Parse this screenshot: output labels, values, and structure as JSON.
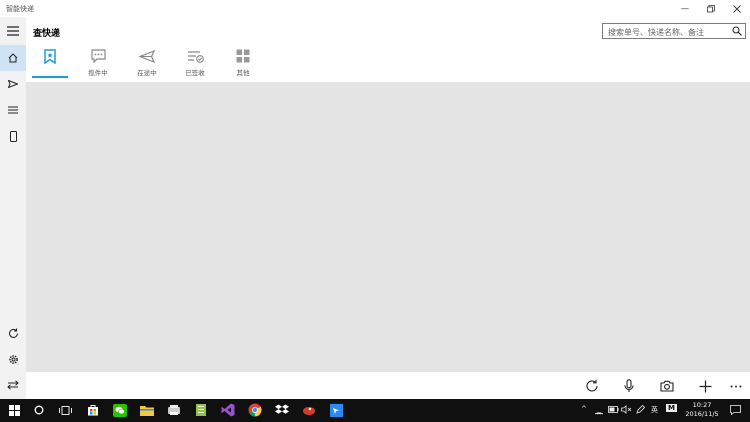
{
  "window": {
    "title": "智能快递",
    "controls": [
      "minimize-icon",
      "restore-icon",
      "close-icon"
    ]
  },
  "sidebar": {
    "items": [
      {
        "name": "menu-icon"
      },
      {
        "name": "home-icon",
        "active": true
      },
      {
        "name": "send-icon"
      },
      {
        "name": "list-icon"
      },
      {
        "name": "phone-icon"
      }
    ],
    "bottom": [
      {
        "name": "refresh-icon"
      },
      {
        "name": "settings-icon"
      },
      {
        "name": "switch-icon"
      }
    ]
  },
  "header": {
    "title": "查快递"
  },
  "search": {
    "placeholder": "搜索单号、快递名称、备注"
  },
  "tabs": [
    {
      "label": "",
      "icon": "bookmark-icon",
      "selected": true
    },
    {
      "label": "揽件中",
      "icon": "chat-icon"
    },
    {
      "label": "在途中",
      "icon": "send-icon"
    },
    {
      "label": "已签收",
      "icon": "checked-list-icon"
    },
    {
      "label": "其他",
      "icon": "grid-icon"
    }
  ],
  "command_bar": [
    "refresh-icon",
    "microphone-icon",
    "camera-icon",
    "add-icon",
    "more-icon"
  ],
  "taskbar": {
    "apps": [
      "start-icon",
      "cortana-icon",
      "task-view-icon",
      "store-icon",
      "wechat-icon",
      "file-explorer-icon",
      "app-icon",
      "notepad-icon",
      "visual-studio-icon",
      "chrome-icon",
      "dropbox-icon",
      "app-icon",
      "app-icon"
    ],
    "tray": {
      "ime": "英",
      "ime2": "M",
      "time": "10:27",
      "date": "2016/11/5"
    }
  },
  "colors": {
    "accent": "#1e9bd7",
    "content_bg": "#e5e5e5",
    "sidebar_bg": "#f2f2f2",
    "taskbar_bg": "#101010"
  }
}
